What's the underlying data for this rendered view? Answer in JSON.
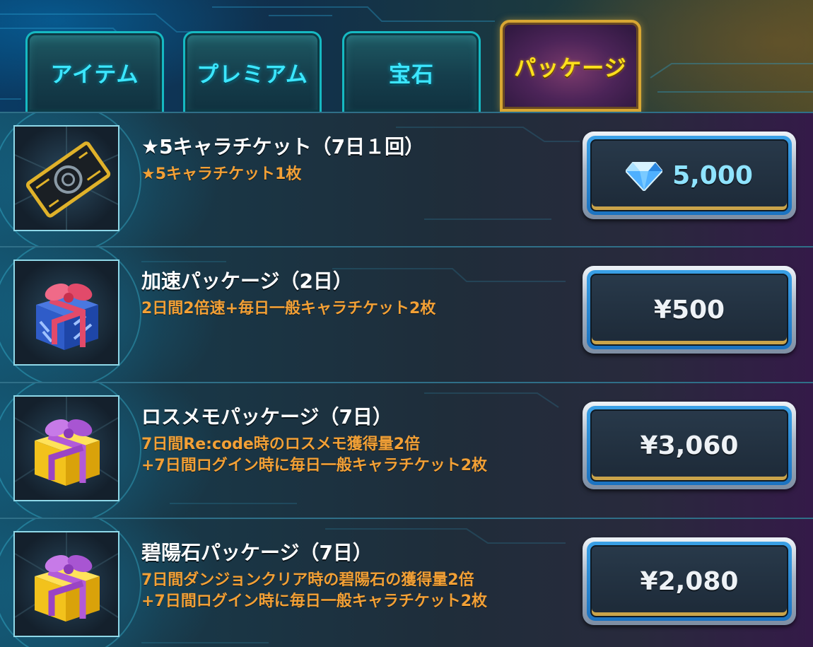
{
  "tabs": [
    {
      "label": "アイテム",
      "active": false
    },
    {
      "label": "プレミアム",
      "active": false
    },
    {
      "label": "宝石",
      "active": false
    },
    {
      "label": "パッケージ",
      "active": true
    }
  ],
  "colors": {
    "tab_text": "#3ce6ff",
    "tab_active_text": "#ffe11c",
    "tab_active_border": "#d8a733",
    "title_text": "#ffffff",
    "desc_text": "#f2a036",
    "price_text": "#eef2f6",
    "gem_price_text": "#8fe3ff"
  },
  "products": [
    {
      "icon": "golden-ticket-icon",
      "title": "★5キャラチケット（7日１回）",
      "description": "★5キャラチケット1枚",
      "price": "5,000",
      "currency_icon": "blue-gem-icon"
    },
    {
      "icon": "blue-gift-box-icon",
      "title": "加速パッケージ（2日）",
      "description": "2日間2倍速+毎日一般キャラチケット2枚",
      "price": "¥500"
    },
    {
      "icon": "yellow-gift-box-icon",
      "title": "ロスメモパッケージ（7日）",
      "description": "7日間Re:code時のロスメモ獲得量2倍\n+7日間ログイン時に毎日一般キャラチケット2枚",
      "price": "¥3,060"
    },
    {
      "icon": "yellow-gift-box-icon",
      "title": "碧陽石パッケージ（7日）",
      "description": "7日間ダンジョンクリア時の碧陽石の獲得量2倍\n+7日間ログイン時に毎日一般キャラチケット2枚",
      "price": "¥2,080"
    }
  ]
}
